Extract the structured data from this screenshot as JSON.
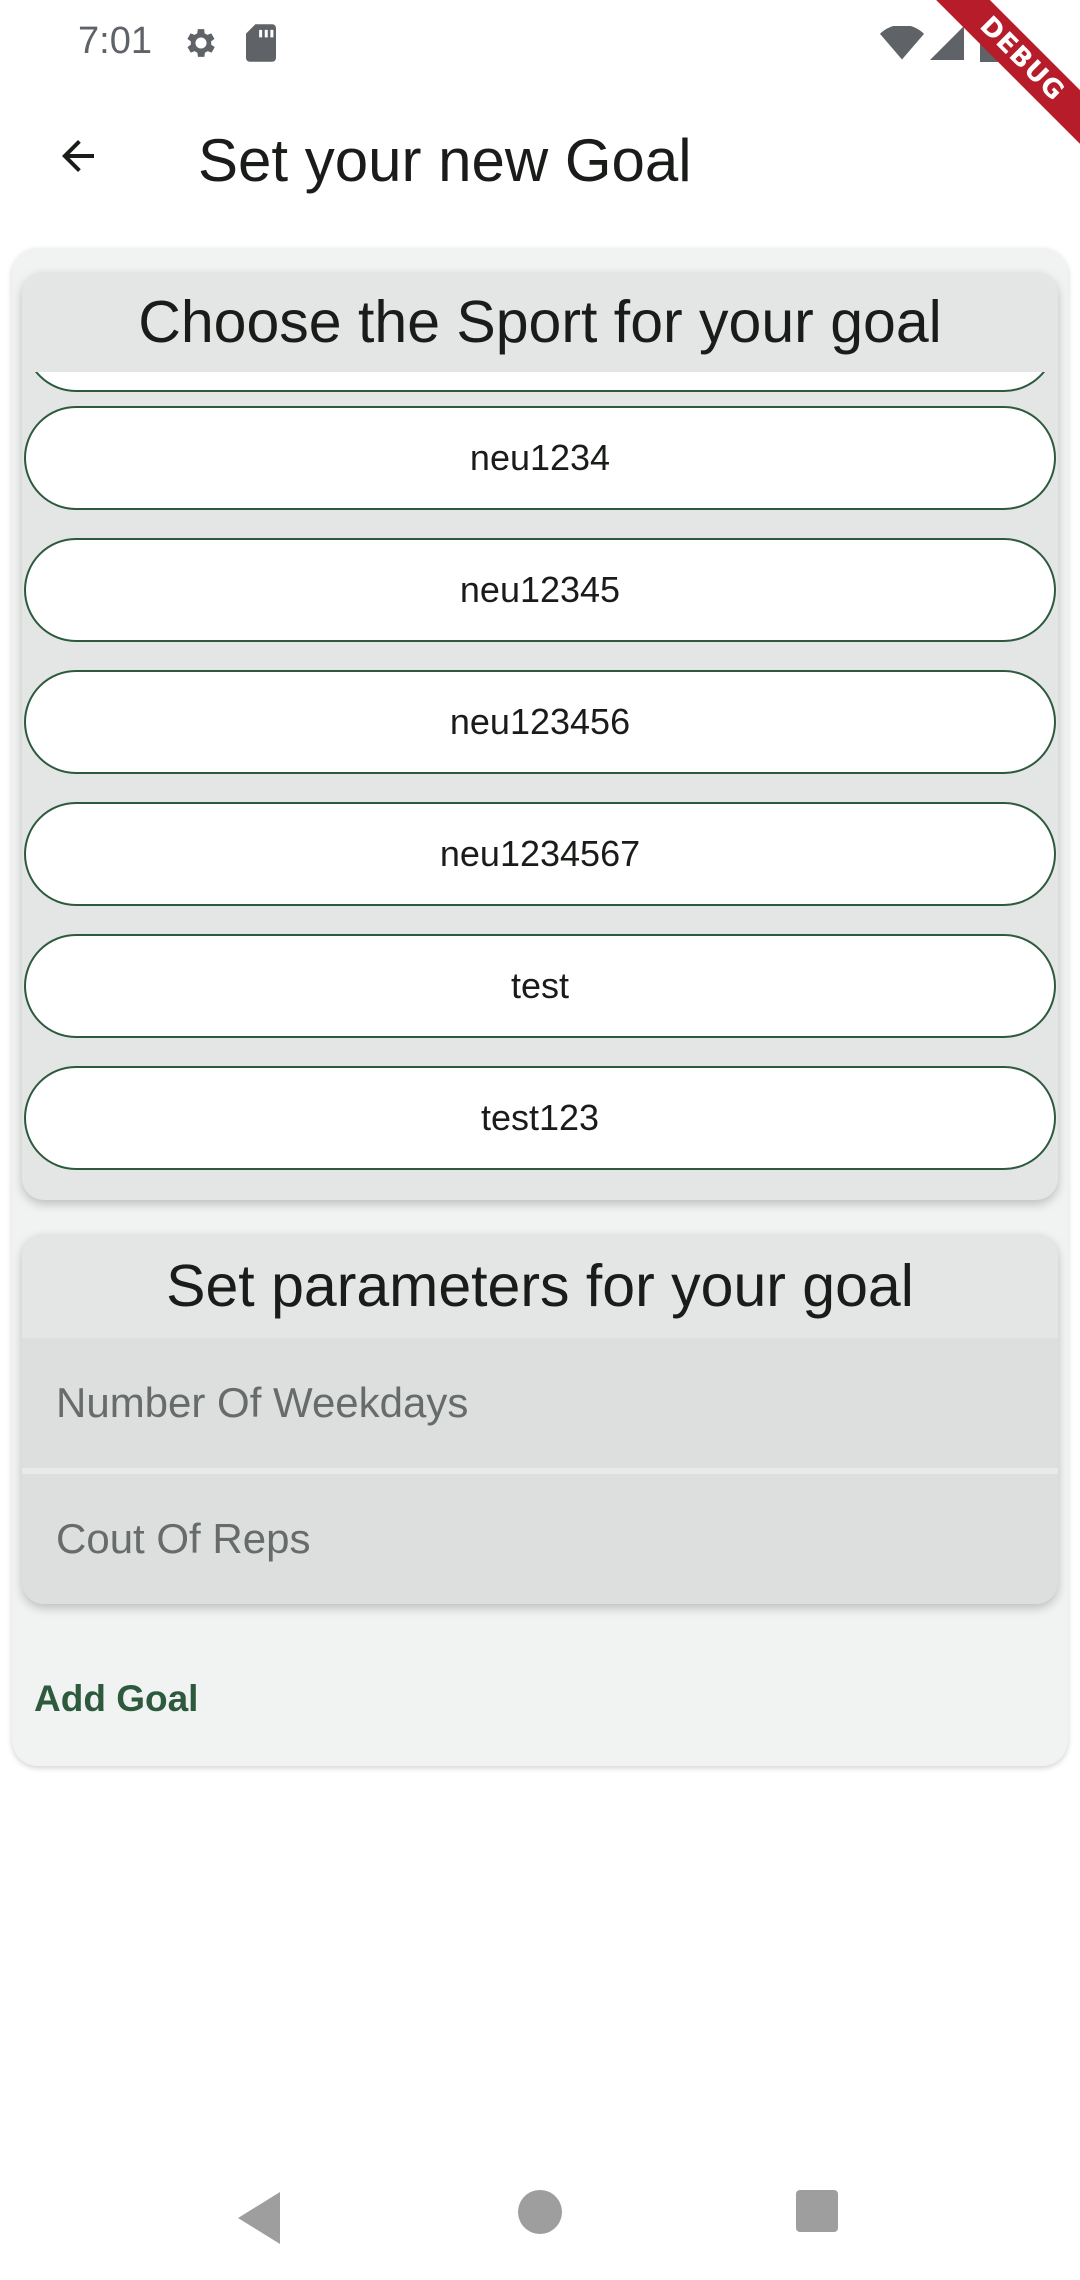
{
  "status_bar": {
    "time": "7:01",
    "icons": [
      "gear-icon",
      "sd-card-icon",
      "wifi-icon",
      "cell-signal-icon",
      "battery-icon"
    ]
  },
  "debug_banner": "DEBUG",
  "app_bar": {
    "back_icon": "arrow-back-icon",
    "title": "Set your new Goal"
  },
  "sport_card": {
    "title": "Choose the Sport for your goal",
    "items": [
      "neu1234",
      "neu12345",
      "neu123456",
      "neu1234567",
      "test",
      "test123"
    ]
  },
  "params_card": {
    "title": "Set parameters for your goal",
    "weekdays_placeholder": "Number Of Weekdays",
    "reps_placeholder": "Cout Of Reps"
  },
  "actions": {
    "add_goal": "Add Goal"
  },
  "nav_bar": {
    "icons": [
      "nav-back-icon",
      "nav-home-icon",
      "nav-recents-icon"
    ]
  },
  "colors": {
    "accent": "#2d5a3d",
    "card_background": "#e3e6e5",
    "debug": "#b71c2a"
  }
}
